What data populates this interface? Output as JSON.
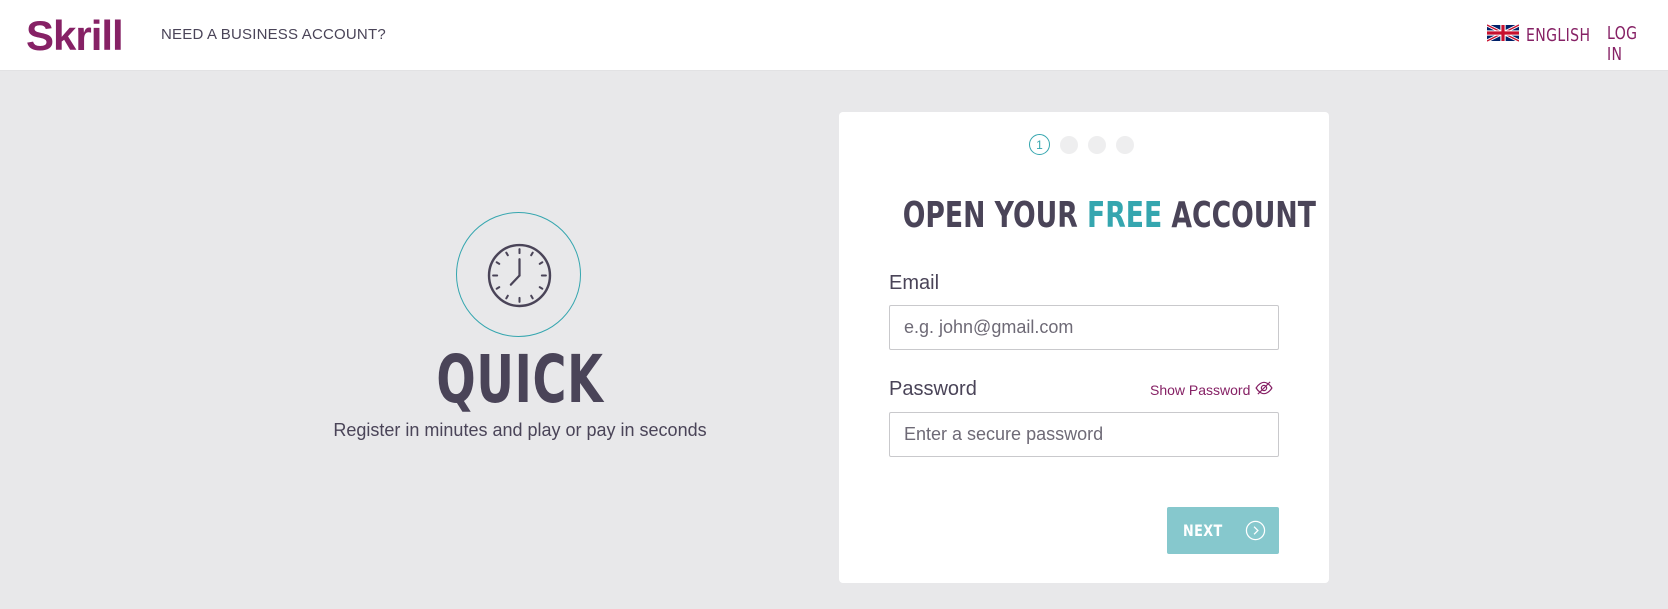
{
  "header": {
    "logo_text": "Skrill",
    "business_link": "NEED A BUSINESS ACCOUNT?",
    "language": "ENGLISH",
    "language_icon": "uk-flag-icon",
    "login": "LOG IN"
  },
  "feature": {
    "icon": "clock-icon",
    "title": "QUICK",
    "subtitle": "Register in minutes and play or pay in seconds"
  },
  "form": {
    "steps": [
      "1",
      "",
      "",
      ""
    ],
    "active_step": 1,
    "title_part1": "OPEN YOUR ",
    "title_accent": "FREE",
    "title_part2": " ACCOUNT",
    "email_label": "Email",
    "email_placeholder": "e.g. john@gmail.com",
    "email_value": "",
    "password_label": "Password",
    "password_placeholder": "Enter a secure password",
    "password_value": "",
    "show_password": "Show Password",
    "show_password_icon": "eye-slash-icon",
    "next_label": "NEXT",
    "next_icon": "chevron-right-circle-icon"
  },
  "colors": {
    "brand": "#862165",
    "accent": "#35a6af",
    "text": "#4a4458",
    "page_background": "#e8e8ea",
    "button_background": "#86c8cd"
  }
}
